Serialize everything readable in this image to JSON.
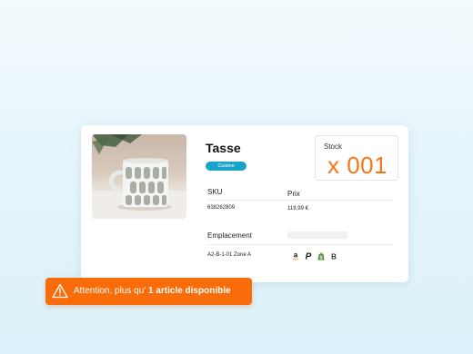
{
  "product": {
    "name": "Tasse",
    "category_tag": "Cuisine"
  },
  "stock": {
    "label": "Stock",
    "value": "x 001"
  },
  "fields": {
    "sku_label": "SKU",
    "sku_value": "638262809",
    "price_label": "Prix",
    "price_value": "119,99 €",
    "location_label": "Emplacement",
    "location_value": "A2-B-1-01  Zone A"
  },
  "channels": [
    "amazon-icon",
    "paypal-icon",
    "shopify-icon",
    "bigcommerce-icon"
  ],
  "alert": {
    "icon": "warning-icon",
    "text_prefix": "Attention, plus qu'",
    "text_strong": "1 article disponible"
  },
  "colors": {
    "accent_orange": "#f96c0a",
    "stock_orange": "#f7761a",
    "tag_blue": "#1aa3c9"
  }
}
